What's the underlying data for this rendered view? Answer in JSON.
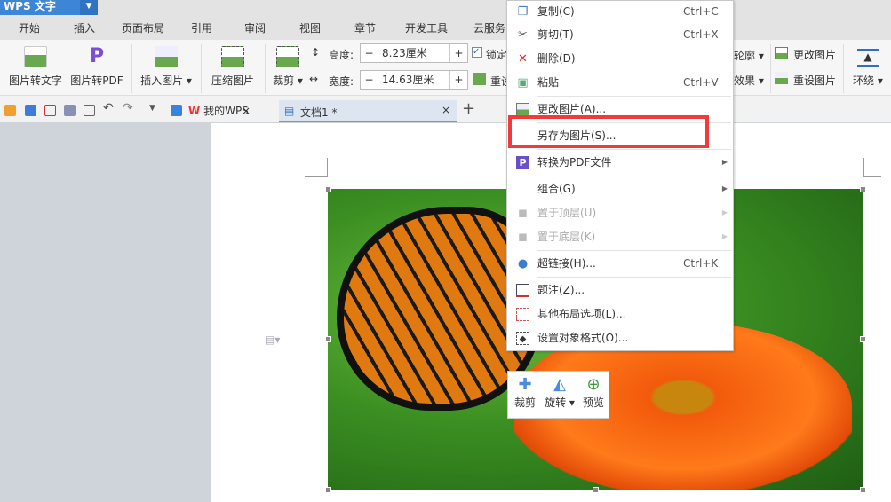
{
  "app": {
    "title": "WPS 文字"
  },
  "menu_tabs": [
    "开始",
    "插入",
    "页面布局",
    "引用",
    "审阅",
    "视图",
    "章节",
    "开发工具",
    "云服务"
  ],
  "ribbon": {
    "img_to_text": "图片转文字",
    "img_to_pdf": "图片转PDF",
    "insert_image": "插入图片",
    "compress": "压缩图片",
    "crop": "裁剪",
    "height_label": "高度:",
    "height_value": "8.23厘米",
    "width_label": "宽度:",
    "width_value": "14.63厘米",
    "lock_label": "锁定",
    "reset_label": "重设",
    "outline": "轮廓",
    "effect": "效果",
    "change_image": "更改图片",
    "reset_image": "重设图片",
    "wrap": "环绕",
    "minus": "−",
    "plus": "+"
  },
  "tabs": [
    {
      "label": "我的WPS"
    },
    {
      "label": "文档1 *"
    }
  ],
  "tab_close": "×",
  "new_tab": "+",
  "context_menu": [
    {
      "label": "复制(C)",
      "shortcut": "Ctrl+C",
      "icon": "copy-icon"
    },
    {
      "label": "剪切(T)",
      "shortcut": "Ctrl+X",
      "icon": "scissors-icon"
    },
    {
      "label": "删除(D)",
      "icon": "delete-icon"
    },
    {
      "label": "粘贴",
      "shortcut": "Ctrl+V",
      "icon": "paste-icon"
    },
    {
      "label": "更改图片(A)...",
      "icon": "change-image-icon"
    },
    {
      "label": "另存为图片(S)..."
    },
    {
      "label": "转换为PDF文件",
      "icon": "pdf-icon",
      "submenu": true
    },
    {
      "label": "组合(G)",
      "submenu": true
    },
    {
      "label": "置于顶层(U)",
      "disabled": true,
      "submenu": true,
      "icon": "bring-front-icon"
    },
    {
      "label": "置于底层(K)",
      "disabled": true,
      "submenu": true,
      "icon": "send-back-icon"
    },
    {
      "label": "超链接(H)...",
      "shortcut": "Ctrl+K",
      "icon": "hyperlink-icon"
    },
    {
      "label": "题注(Z)...",
      "icon": "caption-icon"
    },
    {
      "label": "其他布局选项(L)...",
      "icon": "layout-icon"
    },
    {
      "label": "设置对象格式(O)...",
      "icon": "format-icon"
    }
  ],
  "float_toolbar": {
    "crop": "裁剪",
    "rotate": "旋转",
    "preview": "预览"
  },
  "colors": {
    "accent": "#3d86d6",
    "highlight": "#f23a3a"
  }
}
